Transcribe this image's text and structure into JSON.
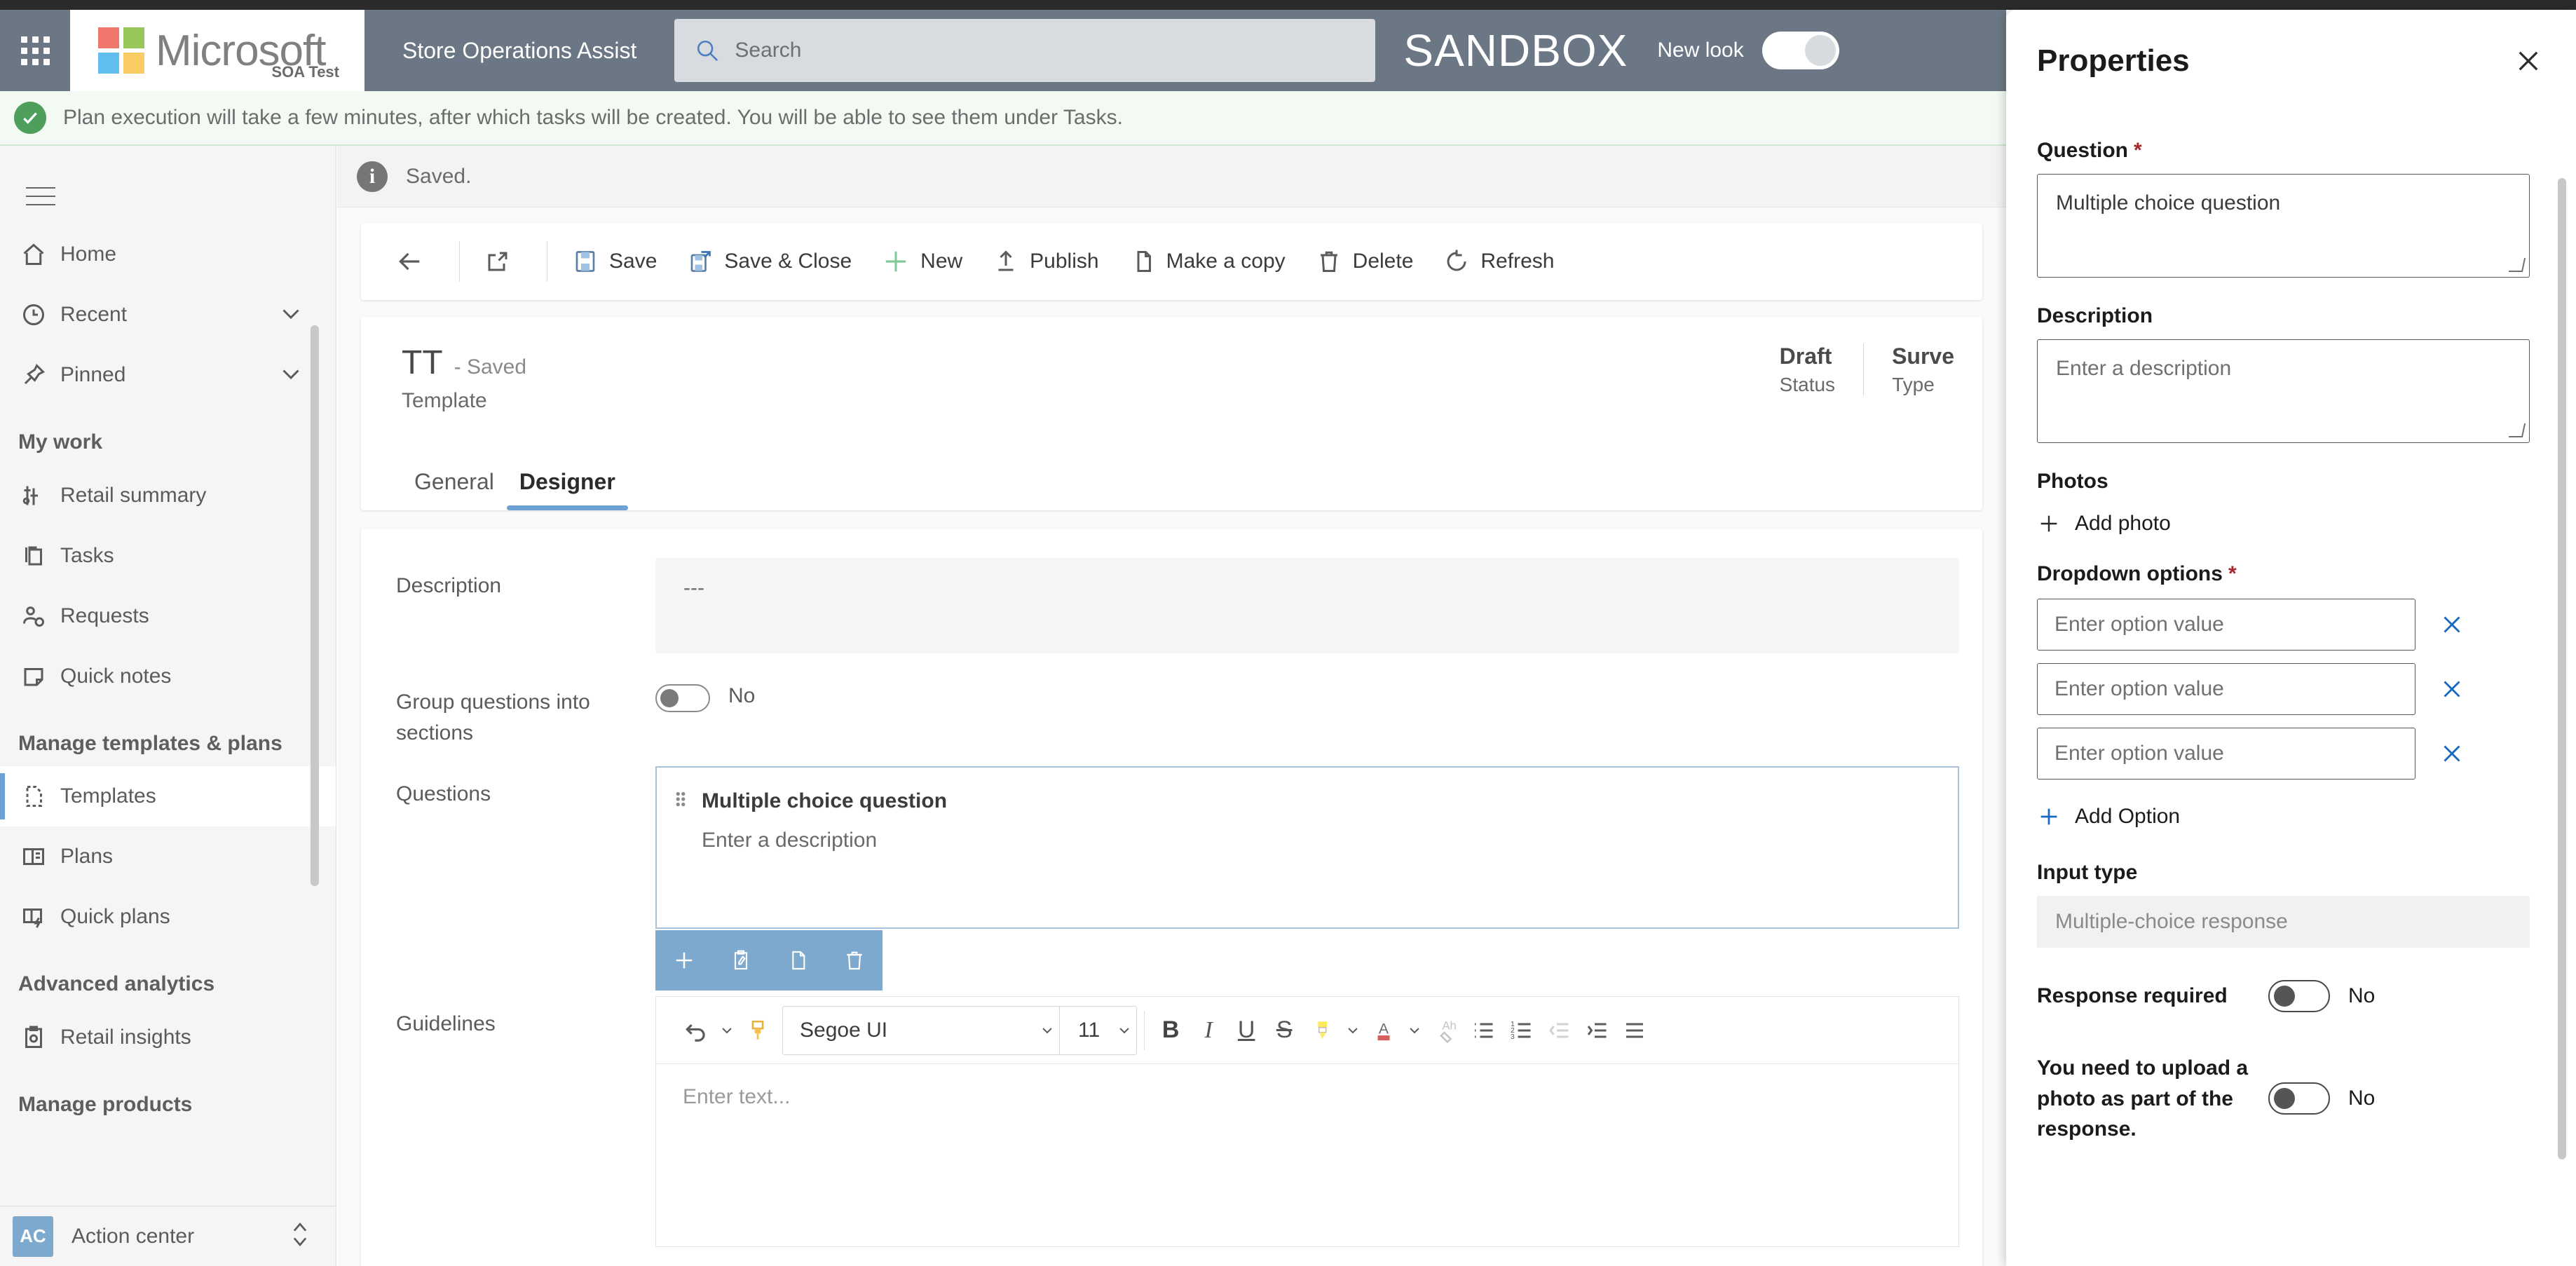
{
  "header": {
    "waffle_label": "app-launcher",
    "brand": "Microsoft",
    "brand_sub": "SOA Test",
    "app_name": "Store Operations Assist",
    "search_placeholder": "Search",
    "search_value": "",
    "environment": "SANDBOX",
    "new_look_label": "New look",
    "new_look_value": "On"
  },
  "notification": {
    "text": "Plan execution will take a few minutes, after which tasks will be created. You will be able to see them under Tasks."
  },
  "sidebar": {
    "items": [
      {
        "label": "Home",
        "icon": "home-icon",
        "expandable": false
      },
      {
        "label": "Recent",
        "icon": "clock-icon",
        "expandable": true
      },
      {
        "label": "Pinned",
        "icon": "pin-icon",
        "expandable": true
      }
    ],
    "groups": [
      {
        "title": "My work",
        "items": [
          {
            "label": "Retail summary",
            "icon": "chart-icon"
          },
          {
            "label": "Tasks",
            "icon": "documents-icon"
          },
          {
            "label": "Requests",
            "icon": "person-question-icon"
          },
          {
            "label": "Quick notes",
            "icon": "note-icon"
          }
        ]
      },
      {
        "title": "Manage templates & plans",
        "items": [
          {
            "label": "Templates",
            "icon": "template-icon",
            "selected": true
          },
          {
            "label": "Plans",
            "icon": "plans-icon"
          },
          {
            "label": "Quick plans",
            "icon": "quick-plans-icon"
          }
        ]
      },
      {
        "title": "Advanced analytics",
        "items": [
          {
            "label": "Retail insights",
            "icon": "clipboard-gear-icon"
          }
        ]
      },
      {
        "title": "Manage products",
        "items": []
      }
    ],
    "footer": {
      "badge": "AC",
      "label": "Action center"
    }
  },
  "main": {
    "status_bar": {
      "text": "Saved."
    },
    "command_bar": {
      "back_label": "Back",
      "popout_label": "Open in new window",
      "buttons": [
        {
          "label": "Save",
          "icon": "save-icon"
        },
        {
          "label": "Save & Close",
          "icon": "save-close-icon"
        },
        {
          "label": "New",
          "icon": "plus-icon"
        },
        {
          "label": "Publish",
          "icon": "publish-icon"
        },
        {
          "label": "Make a copy",
          "icon": "copy-icon"
        },
        {
          "label": "Delete",
          "icon": "trash-icon"
        },
        {
          "label": "Refresh",
          "icon": "refresh-icon"
        }
      ]
    },
    "record": {
      "title": "TT",
      "saved_suffix": "- Saved",
      "subtitle": "Template",
      "meta": [
        {
          "value": "Draft",
          "label": "Status"
        },
        {
          "value": "Surve",
          "label": "Type"
        }
      ],
      "tabs": [
        {
          "label": "General",
          "active": false
        },
        {
          "label": "Designer",
          "active": true
        }
      ]
    },
    "form": {
      "description_label": "Description",
      "description_value": "---",
      "group_sections_label": "Group questions into sections",
      "group_sections_value": "No",
      "questions_label": "Questions",
      "question_card": {
        "title": "Multiple choice question",
        "description": "Enter a description",
        "actions": [
          {
            "name": "add-question-button",
            "icon": "plus-icon"
          },
          {
            "name": "edit-question-button",
            "icon": "edit-icon"
          },
          {
            "name": "duplicate-question-button",
            "icon": "copy-icon"
          },
          {
            "name": "delete-question-button",
            "icon": "trash-icon"
          }
        ]
      },
      "guidelines_label": "Guidelines",
      "editor": {
        "font_family": "Segoe UI",
        "font_size": "11",
        "placeholder": "Enter text...",
        "value": "",
        "buttons": [
          {
            "label": "Undo",
            "icon": "undo-icon"
          },
          {
            "label": "Format painter",
            "icon": "format-painter-icon"
          },
          {
            "label": "Bold",
            "icon": "bold-icon",
            "glyph": "B"
          },
          {
            "label": "Italic",
            "icon": "italic-icon",
            "glyph": "I"
          },
          {
            "label": "Underline",
            "icon": "underline-icon",
            "glyph": "U"
          },
          {
            "label": "Strikethrough",
            "icon": "strikethrough-icon",
            "glyph": "S"
          },
          {
            "label": "Highlight",
            "icon": "highlight-icon"
          },
          {
            "label": "Font color",
            "icon": "font-color-icon"
          },
          {
            "label": "Clear formatting",
            "icon": "clear-formatting-icon"
          },
          {
            "label": "Bulleted list",
            "icon": "bulleted-list-icon"
          },
          {
            "label": "Numbered list",
            "icon": "numbered-list-icon"
          },
          {
            "label": "Decrease indent",
            "icon": "decrease-indent-icon"
          },
          {
            "label": "Increase indent",
            "icon": "increase-indent-icon"
          },
          {
            "label": "Align",
            "icon": "align-icon"
          }
        ]
      }
    }
  },
  "properties": {
    "title": "Properties",
    "close_label": "Close",
    "question": {
      "label": "Question",
      "required": "*",
      "value": "Multiple choice question"
    },
    "description": {
      "label": "Description",
      "placeholder": "Enter a description",
      "value": ""
    },
    "photos": {
      "label": "Photos",
      "add_label": "Add photo"
    },
    "dropdown_options": {
      "label": "Dropdown options",
      "required": "*",
      "options": [
        {
          "placeholder": "Enter option value",
          "value": ""
        },
        {
          "placeholder": "Enter option value",
          "value": ""
        },
        {
          "placeholder": "Enter option value",
          "value": ""
        }
      ],
      "add_label": "Add Option"
    },
    "input_type": {
      "label": "Input type",
      "value": "Multiple-choice response"
    },
    "response_required": {
      "label": "Response required",
      "value": "No"
    },
    "photo_required": {
      "label": "You need to upload a photo as part of the response.",
      "value": "No"
    }
  },
  "colors": {
    "header_bg": "#6c7785",
    "accent_blue": "#6da2d4",
    "panel_accent": "#7EA9CE",
    "success_green": "#4e9e5c",
    "required_red": "#a4262c",
    "link_blue": "#0f6cbd"
  }
}
